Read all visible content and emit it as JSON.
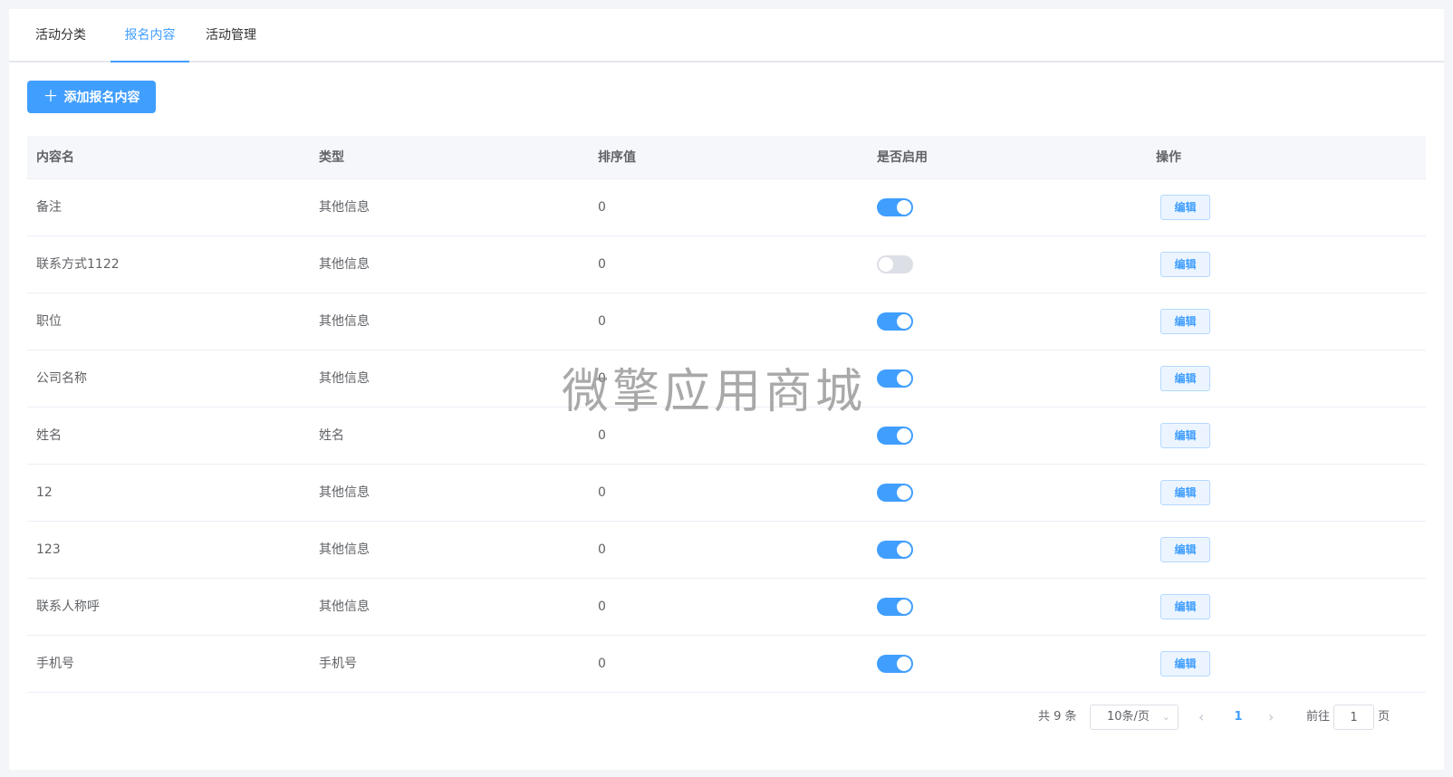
{
  "tabs": [
    {
      "label": "活动分类",
      "active": false
    },
    {
      "label": "报名内容",
      "active": true
    },
    {
      "label": "活动管理",
      "active": false
    }
  ],
  "toolbar": {
    "add_label": "添加报名内容",
    "add_icon": "plus-icon"
  },
  "table": {
    "headers": [
      "内容名",
      "类型",
      "排序值",
      "是否启用",
      "操作"
    ],
    "rows": [
      {
        "name": "备注",
        "type": "其他信息",
        "sort": "0",
        "enabled": true,
        "action": "编辑"
      },
      {
        "name": "联系方式1122",
        "type": "其他信息",
        "sort": "0",
        "enabled": false,
        "action": "编辑"
      },
      {
        "name": "职位",
        "type": "其他信息",
        "sort": "0",
        "enabled": true,
        "action": "编辑"
      },
      {
        "name": "公司名称",
        "type": "其他信息",
        "sort": "0",
        "enabled": true,
        "action": "编辑"
      },
      {
        "name": "姓名",
        "type": "姓名",
        "sort": "0",
        "enabled": true,
        "action": "编辑"
      },
      {
        "name": "12",
        "type": "其他信息",
        "sort": "0",
        "enabled": true,
        "action": "编辑"
      },
      {
        "name": "123",
        "type": "其他信息",
        "sort": "0",
        "enabled": true,
        "action": "编辑"
      },
      {
        "name": "联系人称呼",
        "type": "其他信息",
        "sort": "0",
        "enabled": true,
        "action": "编辑"
      },
      {
        "name": "手机号",
        "type": "手机号",
        "sort": "0",
        "enabled": true,
        "action": "编辑"
      }
    ]
  },
  "watermark": "微擎应用商城",
  "pagination": {
    "total": "共 9 条",
    "page_size": "10条/页",
    "current_page": "1",
    "goto_label": "前往",
    "goto_value": "1",
    "page_suffix": "页"
  },
  "colors": {
    "accent": "#409eff",
    "switch_off": "#dcdfe6",
    "background": "#f4f5f8"
  }
}
